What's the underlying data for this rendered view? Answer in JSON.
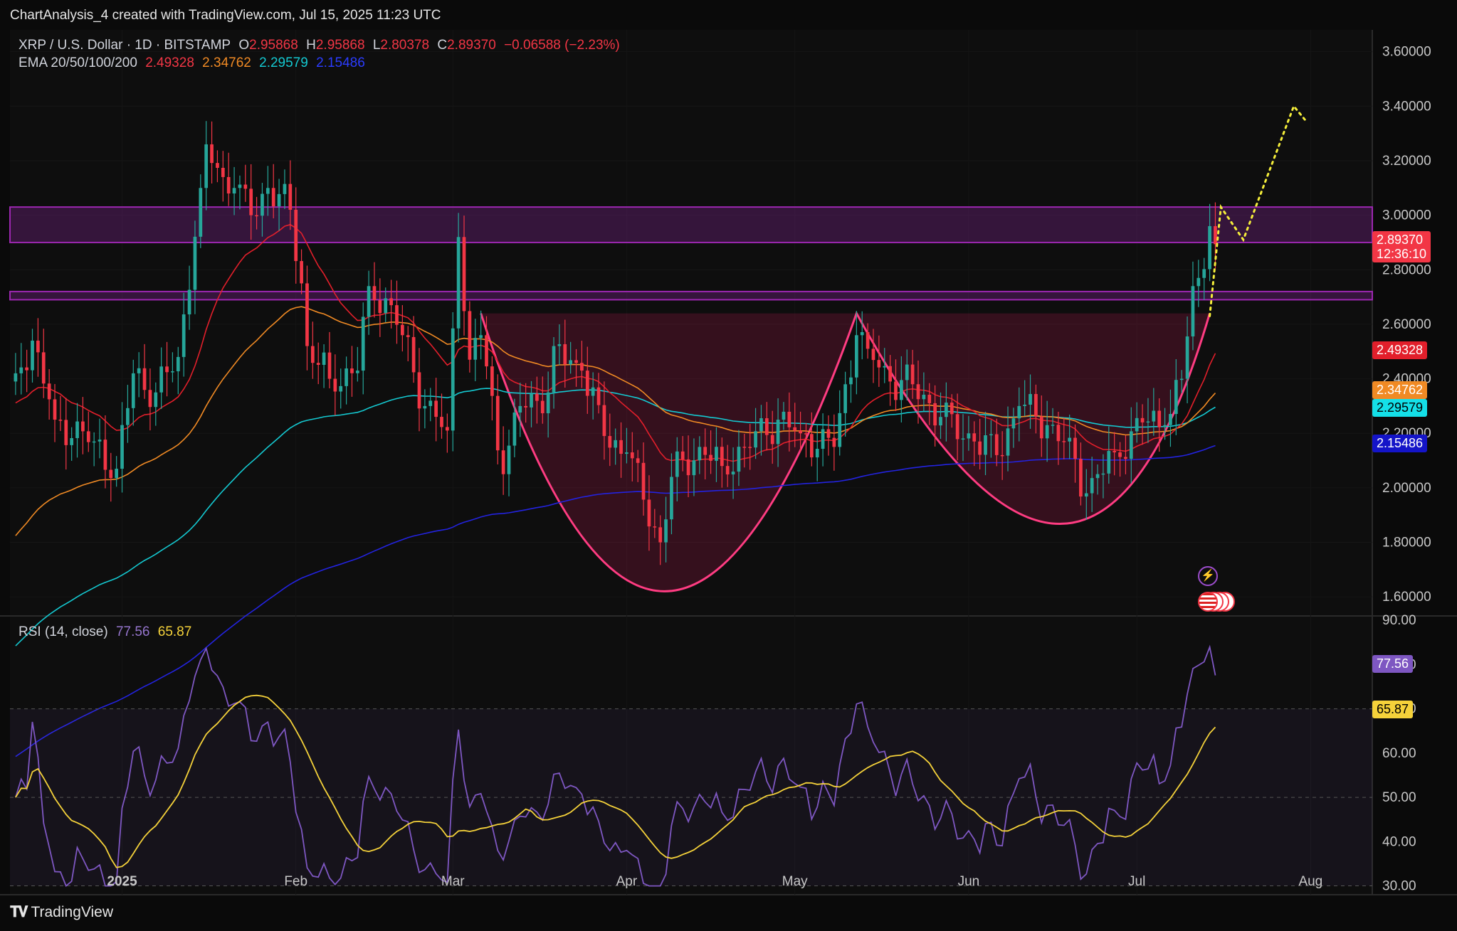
{
  "header": {
    "created_by": "ChartAnalysis_4 created with TradingView.com, Jul 15, 2025 11:23 UTC",
    "symbol": "XRP / U.S. Dollar · 1D · BITSTAMP",
    "o_label": "O",
    "o_value": "2.95868",
    "h_label": "H",
    "h_value": "2.95868",
    "l_label": "L",
    "l_value": "2.80378",
    "c_label": "C",
    "c_value": "2.89370",
    "change": "−0.06588 (−2.23%)",
    "ema_label": "EMA 20/50/100/200",
    "ema20": "2.49328",
    "ema50": "2.34762",
    "ema100": "2.29579",
    "ema200": "2.15486",
    "rsi_label": "RSI (14, close)",
    "rsi_value": "77.56",
    "rsi_ma_value": "65.87"
  },
  "footer": {
    "brand": "TradingView"
  },
  "price_labels": {
    "last_price": "2.89370",
    "countdown": "12:36:10",
    "ema20": "2.49328",
    "ema50": "2.34762",
    "ema100": "2.29579",
    "ema200": "2.15486",
    "rsi": "77.56",
    "rsi_ma": "65.87"
  },
  "colors": {
    "up": "#26a69a",
    "down": "#f23645",
    "ema20": "#e21f2b",
    "ema50": "#f08a24",
    "ema100": "#14c9d1",
    "ema200": "#2323e0",
    "rsi": "#7e57c2",
    "rsi_ma": "#f5d23a",
    "zone": "#9c27b0",
    "pattern": "#ff3c82",
    "projection": "#f5ee3a"
  },
  "chart_data": [
    {
      "type": "candlestick",
      "title": "XRP / U.S. Dollar · 1D · BITSTAMP",
      "y_ticks": [
        "3.60000",
        "3.40000",
        "3.20000",
        "3.00000",
        "2.80000",
        "2.60000",
        "2.40000",
        "2.20000",
        "2.00000",
        "1.80000",
        "1.60000"
      ],
      "ylim": [
        1.53,
        3.68
      ],
      "x_ticks": [
        "2025",
        "Feb",
        "Mar",
        "Apr",
        "May",
        "Jun",
        "Jul",
        "Aug"
      ],
      "x_range": [
        "2024-12-12",
        "2025-08-12"
      ],
      "resistance_zones": [
        [
          2.9,
          3.03
        ],
        [
          2.69,
          2.72
        ]
      ],
      "pattern": "double bottom",
      "pattern_neckline": 2.64,
      "pattern_bottoms": [
        {
          "date": "2025-04-07",
          "value": 1.61
        },
        {
          "date": "2025-06-22",
          "value": 1.86
        }
      ],
      "projection_path": [
        [
          "2025-07-14",
          2.63
        ],
        [
          "2025-07-16",
          3.03
        ],
        [
          "2025-07-20",
          2.91
        ],
        [
          "2025-07-29",
          3.4
        ],
        [
          "2025-07-31",
          3.35
        ]
      ],
      "last_close": 2.8937,
      "ema_last": {
        "ema20": 2.49328,
        "ema50": 2.34762,
        "ema100": 2.29579,
        "ema200": 2.15486
      },
      "candles_keypoints": [
        [
          "2024-12-13",
          2.42
        ],
        [
          "2024-12-16",
          2.54
        ],
        [
          "2024-12-20",
          2.25
        ],
        [
          "2024-12-27",
          2.17
        ],
        [
          "2024-12-31",
          2.07
        ],
        [
          "2025-01-03",
          2.42
        ],
        [
          "2025-01-07",
          2.35
        ],
        [
          "2025-01-11",
          2.48
        ],
        [
          "2025-01-15",
          3.1
        ],
        [
          "2025-01-16",
          3.26
        ],
        [
          "2025-01-19",
          3.14
        ],
        [
          "2025-01-21",
          3.1
        ],
        [
          "2025-01-24",
          3.0
        ],
        [
          "2025-01-27",
          3.1
        ],
        [
          "2025-01-31",
          3.02
        ],
        [
          "2025-02-02",
          2.75
        ],
        [
          "2025-02-03",
          2.52
        ],
        [
          "2025-02-07",
          2.4
        ],
        [
          "2025-02-12",
          2.43
        ],
        [
          "2025-02-14",
          2.74
        ],
        [
          "2025-02-18",
          2.67
        ],
        [
          "2025-02-20",
          2.56
        ],
        [
          "2025-02-24",
          2.3
        ],
        [
          "2025-02-28",
          2.21
        ],
        [
          "2025-03-02",
          2.92
        ],
        [
          "2025-03-04",
          2.47
        ],
        [
          "2025-03-06",
          2.56
        ],
        [
          "2025-03-10",
          2.05
        ],
        [
          "2025-03-13",
          2.3
        ],
        [
          "2025-03-18",
          2.35
        ],
        [
          "2025-03-19",
          2.52
        ],
        [
          "2025-03-24",
          2.43
        ],
        [
          "2025-03-28",
          2.19
        ],
        [
          "2025-04-01",
          2.13
        ],
        [
          "2025-04-07",
          1.8
        ],
        [
          "2025-04-09",
          2.04
        ],
        [
          "2025-04-14",
          2.15
        ],
        [
          "2025-04-18",
          2.08
        ],
        [
          "2025-04-22",
          2.15
        ],
        [
          "2025-04-28",
          2.25
        ],
        [
          "2025-05-02",
          2.2
        ],
        [
          "2025-05-08",
          2.15
        ],
        [
          "2025-05-12",
          2.56
        ],
        [
          "2025-05-14",
          2.51
        ],
        [
          "2025-05-18",
          2.39
        ],
        [
          "2025-05-22",
          2.38
        ],
        [
          "2025-05-27",
          2.26
        ],
        [
          "2025-06-02",
          2.17
        ],
        [
          "2025-06-06",
          2.12
        ],
        [
          "2025-06-10",
          2.3
        ],
        [
          "2025-06-15",
          2.23
        ],
        [
          "2025-06-18",
          2.17
        ],
        [
          "2025-06-22",
          1.98
        ],
        [
          "2025-06-27",
          2.13
        ],
        [
          "2025-07-02",
          2.24
        ],
        [
          "2025-07-06",
          2.23
        ],
        [
          "2025-07-09",
          2.4
        ],
        [
          "2025-07-11",
          2.74
        ],
        [
          "2025-07-12",
          2.77
        ],
        [
          "2025-07-14",
          2.96
        ],
        [
          "2025-07-15",
          2.8937
        ]
      ]
    },
    {
      "type": "line",
      "title": "RSI (14, close)",
      "y_ticks": [
        "90.00",
        "80.00",
        "70.00",
        "60.00",
        "50.00",
        "40.00",
        "30.00"
      ],
      "ylim": [
        28,
        91
      ],
      "levels": [
        70,
        50,
        30
      ],
      "series": [
        {
          "name": "RSI",
          "last": 77.56
        },
        {
          "name": "RSI-based MA",
          "last": 65.87
        }
      ]
    }
  ]
}
